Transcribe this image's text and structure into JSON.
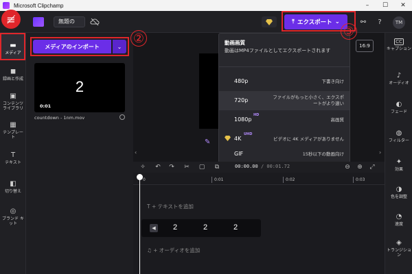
{
  "window": {
    "title": "Microsoft Clipchamp",
    "controls": [
      "–",
      "☐",
      "✕"
    ]
  },
  "topbar": {
    "project_name": "無題の",
    "export_label": "エクスポート",
    "avatar": "TM"
  },
  "sidebar": {
    "items": [
      {
        "label": "メディア",
        "icon": "folder-icon",
        "glyph": "▬"
      },
      {
        "label": "録画と作成",
        "icon": "camera-icon",
        "glyph": "◼"
      },
      {
        "label": "コンテンツ ライブラリ",
        "icon": "library-icon",
        "glyph": "▣"
      },
      {
        "label": "テンプレート",
        "icon": "template-icon",
        "glyph": "▦"
      },
      {
        "label": "テキスト",
        "icon": "text-icon",
        "glyph": "T"
      },
      {
        "label": "切り替え",
        "icon": "transition-icon",
        "glyph": "◧"
      },
      {
        "label": "ブランド キット",
        "icon": "brand-kit-icon",
        "glyph": "◎"
      }
    ]
  },
  "media": {
    "import_label": "メディアのインポート",
    "thumb_number": "2",
    "thumb_duration": "0:01",
    "file_name": "countdown - 1nm.mov"
  },
  "preview": {
    "aspect_ratio": "16:9"
  },
  "export_menu": {
    "title": "動画画質",
    "description": "動画はMP4ファイルとしてエクスポートされます",
    "options": [
      {
        "res": "480p",
        "badge": "",
        "note": "下書き向け"
      },
      {
        "res": "720p",
        "badge": "",
        "note": "ファイルがもっと小さく、エクスポートがより速い"
      },
      {
        "res": "1080p",
        "badge": "HD",
        "note": "高画質"
      },
      {
        "res": "4K",
        "badge": "UHD",
        "note": "ビデオに 4K メディアがありません"
      },
      {
        "res": "GIF",
        "badge": "",
        "note": "15秒以下の動画向け"
      }
    ]
  },
  "timeline": {
    "time_current": "00:00.00",
    "time_total": "/ 00:01.72",
    "ticks": [
      "0",
      "0:01",
      "0:02",
      "0:03"
    ],
    "add_text": "T  + テキストを追加",
    "add_audio": "♫  + オーディオを追加",
    "clip_numbers": [
      "2",
      "2",
      "2"
    ]
  },
  "rightbar": {
    "items": [
      {
        "label": "キャプション",
        "icon": "captions-icon",
        "glyph": "CC"
      },
      {
        "label": "オーディオ",
        "icon": "audio-icon",
        "glyph": "♪"
      },
      {
        "label": "フェード",
        "icon": "fade-icon",
        "glyph": "◐"
      },
      {
        "label": "フィルター",
        "icon": "filter-icon",
        "glyph": "◍"
      },
      {
        "label": "効果",
        "icon": "effects-icon",
        "glyph": "✦"
      },
      {
        "label": "色を調整",
        "icon": "color-adjust-icon",
        "glyph": "◑"
      },
      {
        "label": "速度",
        "icon": "speed-icon",
        "glyph": "◔"
      },
      {
        "label": "トランジション",
        "icon": "transition-icon",
        "glyph": "◈"
      }
    ]
  },
  "annotations": {
    "step1": "≢",
    "step2": "②",
    "step3": "③"
  },
  "colors": {
    "accent": "#6b2ee8",
    "annotation": "#e0262b"
  }
}
